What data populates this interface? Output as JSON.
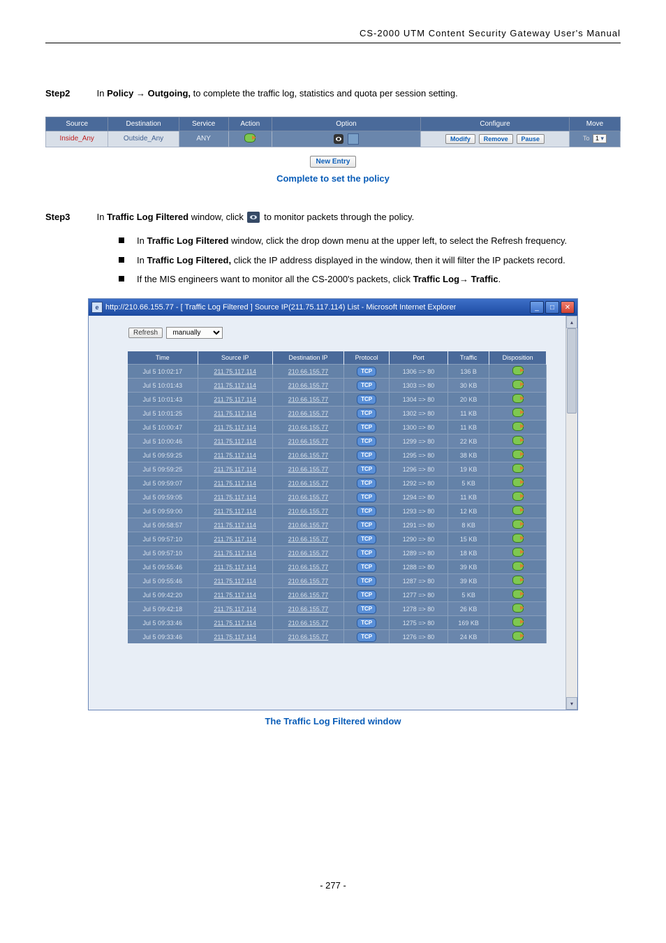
{
  "header": "CS-2000 UTM Content Security Gateway User's Manual",
  "step2": {
    "label": "Step2",
    "text_pre": "In ",
    "bold1": "Policy",
    "arrow": " → ",
    "bold2": "Outgoing,",
    "text_post": " to complete the traffic log, statistics and quota per session setting."
  },
  "policy_table": {
    "headers": [
      "Source",
      "Destination",
      "Service",
      "Action",
      "Option",
      "Configure",
      "Move"
    ],
    "row": {
      "source": "Inside_Any",
      "destination": "Outside_Any",
      "service": "ANY",
      "modify": "Modify",
      "remove": "Remove",
      "pause": "Pause",
      "move_to": "To",
      "move_sel": "1"
    },
    "new_entry": "New Entry"
  },
  "caption1": "Complete to set the policy",
  "step3": {
    "label": "Step3",
    "pre": "In ",
    "bold": "Traffic Log Filtered",
    "mid": " window, click ",
    "post": " to monitor packets through the policy."
  },
  "bullets": [
    {
      "pre": "In ",
      "b": "Traffic Log Filtered",
      "post": " window, click the drop down menu at the upper left, to select the Refresh frequency."
    },
    {
      "pre": "In ",
      "b": "Traffic Log Filtered,",
      "post": " click the IP address displayed in the window, then it will filter the IP packets record."
    },
    {
      "pre": "If the MIS engineers want to monitor all the CS-2000's packets, click ",
      "b": "Traffic Log",
      "arrow": "→ ",
      "b2": "Traffic",
      "post": "."
    }
  ],
  "ie": {
    "title": "http://210.66.155.77 - [ Traffic Log Filtered ] Source IP(211.75.117.114) List - Microsoft Internet Explorer",
    "refresh": "Refresh",
    "manually": "manually"
  },
  "log": {
    "headers": [
      "Time",
      "Source IP",
      "Destination IP",
      "Protocol",
      "Port",
      "Traffic",
      "Disposition"
    ],
    "rows": [
      {
        "t": "Jul 5 10:02:17",
        "s": "211.75.117.114",
        "d": "210.66.155.77",
        "p": "TCP",
        "port": "1306 => 80",
        "tr": "136 B"
      },
      {
        "t": "Jul 5 10:01:43",
        "s": "211.75.117.114",
        "d": "210.66.155.77",
        "p": "TCP",
        "port": "1303 => 80",
        "tr": "30 KB"
      },
      {
        "t": "Jul 5 10:01:43",
        "s": "211.75.117.114",
        "d": "210.66.155.77",
        "p": "TCP",
        "port": "1304 => 80",
        "tr": "20 KB"
      },
      {
        "t": "Jul 5 10:01:25",
        "s": "211.75.117.114",
        "d": "210.66.155.77",
        "p": "TCP",
        "port": "1302 => 80",
        "tr": "11 KB"
      },
      {
        "t": "Jul 5 10:00:47",
        "s": "211.75.117.114",
        "d": "210.66.155.77",
        "p": "TCP",
        "port": "1300 => 80",
        "tr": "11 KB"
      },
      {
        "t": "Jul 5 10:00:46",
        "s": "211.75.117.114",
        "d": "210.66.155.77",
        "p": "TCP",
        "port": "1299 => 80",
        "tr": "22 KB"
      },
      {
        "t": "Jul 5 09:59:25",
        "s": "211.75.117.114",
        "d": "210.66.155.77",
        "p": "TCP",
        "port": "1295 => 80",
        "tr": "38 KB"
      },
      {
        "t": "Jul 5 09:59:25",
        "s": "211.75.117.114",
        "d": "210.66.155.77",
        "p": "TCP",
        "port": "1296 => 80",
        "tr": "19 KB"
      },
      {
        "t": "Jul 5 09:59:07",
        "s": "211.75.117.114",
        "d": "210.66.155.77",
        "p": "TCP",
        "port": "1292 => 80",
        "tr": "5 KB"
      },
      {
        "t": "Jul 5 09:59:05",
        "s": "211.75.117.114",
        "d": "210.66.155.77",
        "p": "TCP",
        "port": "1294 => 80",
        "tr": "11 KB"
      },
      {
        "t": "Jul 5 09:59:00",
        "s": "211.75.117.114",
        "d": "210.66.155.77",
        "p": "TCP",
        "port": "1293 => 80",
        "tr": "12 KB"
      },
      {
        "t": "Jul 5 09:58:57",
        "s": "211.75.117.114",
        "d": "210.66.155.77",
        "p": "TCP",
        "port": "1291 => 80",
        "tr": "8 KB"
      },
      {
        "t": "Jul 5 09:57:10",
        "s": "211.75.117.114",
        "d": "210.66.155.77",
        "p": "TCP",
        "port": "1290 => 80",
        "tr": "15 KB"
      },
      {
        "t": "Jul 5 09:57:10",
        "s": "211.75.117.114",
        "d": "210.66.155.77",
        "p": "TCP",
        "port": "1289 => 80",
        "tr": "18 KB"
      },
      {
        "t": "Jul 5 09:55:46",
        "s": "211.75.117.114",
        "d": "210.66.155.77",
        "p": "TCP",
        "port": "1288 => 80",
        "tr": "39 KB"
      },
      {
        "t": "Jul 5 09:55:46",
        "s": "211.75.117.114",
        "d": "210.66.155.77",
        "p": "TCP",
        "port": "1287 => 80",
        "tr": "39 KB"
      },
      {
        "t": "Jul 5 09:42:20",
        "s": "211.75.117.114",
        "d": "210.66.155.77",
        "p": "TCP",
        "port": "1277 => 80",
        "tr": "5 KB"
      },
      {
        "t": "Jul 5 09:42:18",
        "s": "211.75.117.114",
        "d": "210.66.155.77",
        "p": "TCP",
        "port": "1278 => 80",
        "tr": "26 KB"
      },
      {
        "t": "Jul 5 09:33:46",
        "s": "211.75.117.114",
        "d": "210.66.155.77",
        "p": "TCP",
        "port": "1275 => 80",
        "tr": "169 KB"
      },
      {
        "t": "Jul 5 09:33:46",
        "s": "211.75.117.114",
        "d": "210.66.155.77",
        "p": "TCP",
        "port": "1276 => 80",
        "tr": "24 KB"
      }
    ]
  },
  "caption2": "The Traffic Log Filtered window",
  "page_no": "- 277 -"
}
